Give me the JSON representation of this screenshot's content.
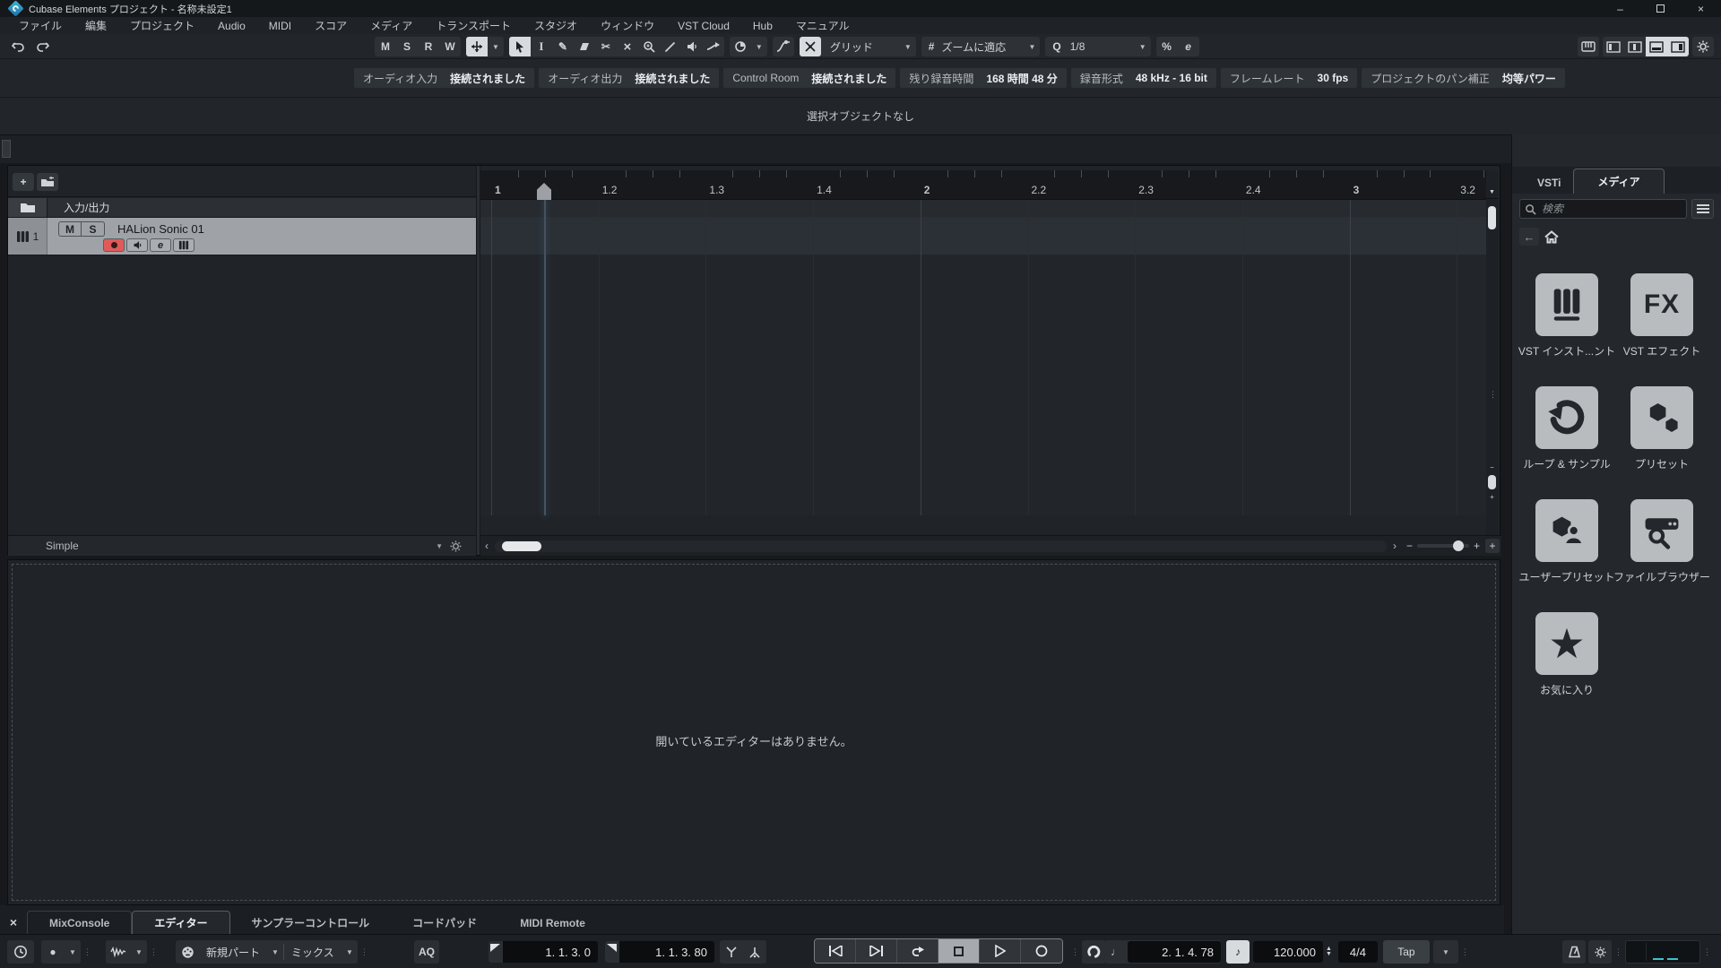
{
  "window": {
    "title": "Cubase Elements プロジェクト - 名称未設定1"
  },
  "icons": {
    "dropdown": "▼",
    "up": "▲",
    "close": "×",
    "minimize": "–",
    "back": "←",
    "grip": "⋮",
    "chevron_left": "‹",
    "chevron_right": "›",
    "plus": "+",
    "minus": "−",
    "hash": "#",
    "percent": "%",
    "scissors": "✂",
    "pencil": "✎",
    "mute_x": "×",
    "note": "♪",
    "quarter": "♩",
    "star": "★",
    "prev_tri": "◀",
    "next_tri": "▶",
    "play_tri": "▶",
    "record_dot": "●",
    "record_circle": "○",
    "gear": "⚙"
  },
  "menu": {
    "items": [
      "ファイル",
      "編集",
      "プロジェクト",
      "Audio",
      "MIDI",
      "スコア",
      "メディア",
      "トランスポート",
      "スタジオ",
      "ウィンドウ",
      "VST Cloud",
      "Hub",
      "マニュアル"
    ]
  },
  "toolbar": {
    "monitor": [
      "M",
      "S",
      "R",
      "W"
    ],
    "grid_mode": "グリッド",
    "zoom_mode": "ズームに適応",
    "quantize_label": "Q",
    "quantize_value": "1/8",
    "quantize_panel": "e"
  },
  "info_line": {
    "chips": [
      {
        "label": "オーディオ入力",
        "value": "接続されました"
      },
      {
        "label": "オーディオ出力",
        "value": "接続されました"
      },
      {
        "label": "Control Room",
        "value": "接続されました"
      },
      {
        "label": "残り録音時間",
        "value": "168 時間 48 分"
      },
      {
        "label": "録音形式",
        "value": "48 kHz - 16 bit"
      },
      {
        "label": "フレームレート",
        "value": "30 fps"
      },
      {
        "label": "プロジェクトのパン補正",
        "value": "均等パワー"
      }
    ]
  },
  "status_line": {
    "text": "選択オブジェクトなし"
  },
  "track_list": {
    "io_label": "入力/出力",
    "track_number": "1",
    "mute": "M",
    "solo": "S",
    "track_name": "HALion Sonic 01",
    "edit": "e",
    "zoom_preset": "Simple"
  },
  "ruler": {
    "ticks": [
      "1",
      "1.2",
      "1.3",
      "1.4",
      "2",
      "2.2",
      "2.3",
      "2.4",
      "3",
      "3.2"
    ]
  },
  "right_zone": {
    "tabs": [
      "VSTi",
      "メディア"
    ],
    "active_tab": "メディア",
    "search_placeholder": "検索",
    "fx_text": "FX",
    "tiles": [
      {
        "icon": "piano-icon",
        "label": "VST インスト...ント"
      },
      {
        "icon": "fx-icon",
        "label": "VST エフェクト"
      },
      {
        "icon": "loop-icon",
        "label": "ループ & サンプル"
      },
      {
        "icon": "hexagons-icon",
        "label": "プリセット"
      },
      {
        "icon": "user-preset-icon",
        "label": "ユーザープリセット"
      },
      {
        "icon": "file-browser-icon",
        "label": "ファイルブラウザー"
      },
      {
        "icon": "star-icon",
        "label": "お気に入り"
      }
    ]
  },
  "lower_zone": {
    "message": "開いているエディターはありません。",
    "tabs": [
      "MixConsole",
      "エディター",
      "サンプラーコントロール",
      "コードパッド",
      "MIDI Remote"
    ],
    "active_tab": "エディター"
  },
  "transport": {
    "record_part_mode": "新規パート",
    "record_mix_mode": "ミックス",
    "aq": "AQ",
    "left_locator": "1. 1. 3. 0",
    "right_locator": "1. 1. 3. 80",
    "position": "2. 1. 4. 78",
    "tempo": "120.000",
    "time_signature": "4/4",
    "tap": "Tap"
  }
}
